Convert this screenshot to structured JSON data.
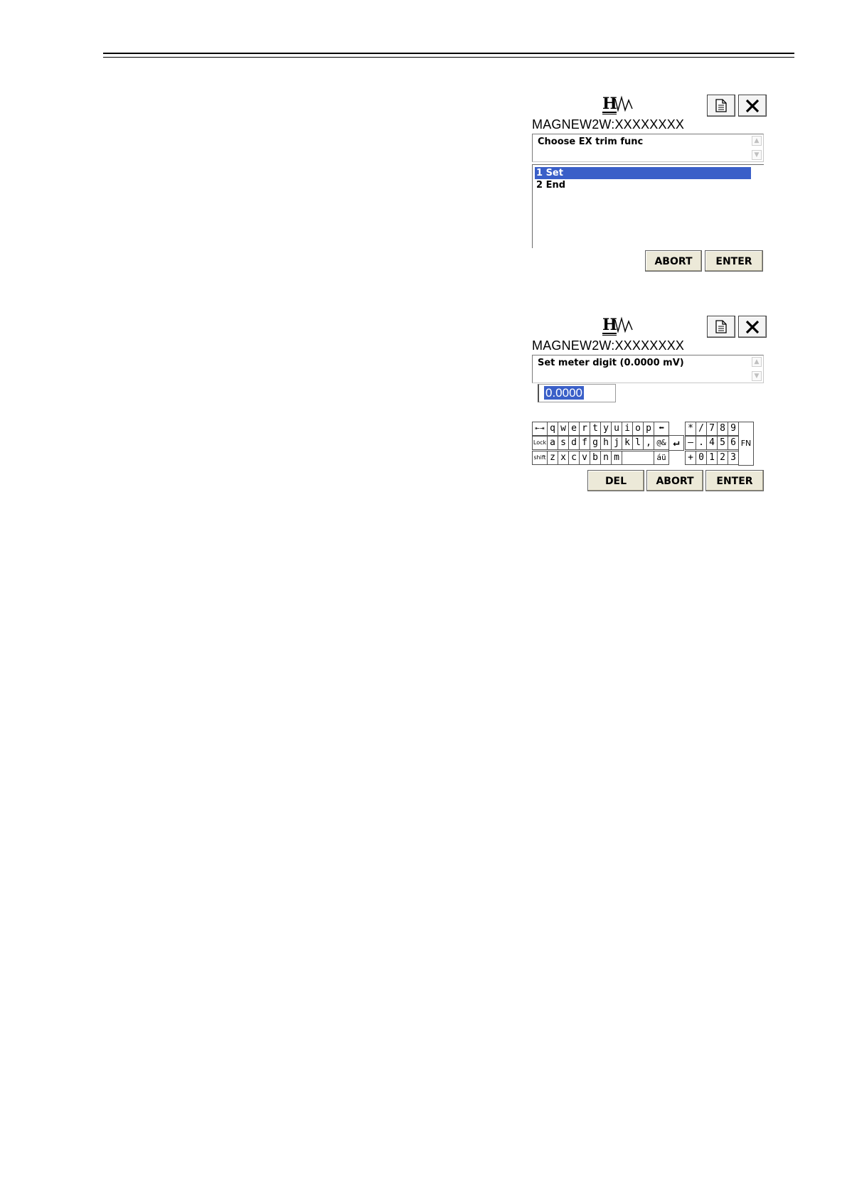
{
  "screen1": {
    "device_name": "MAGNEW2W:XXXXXXXX",
    "prompt": "Choose EX trim func",
    "options": [
      {
        "label": "1 Set",
        "selected": true
      },
      {
        "label": "2 End",
        "selected": false
      }
    ],
    "buttons": {
      "abort": "ABORT",
      "enter": "ENTER"
    },
    "icons": {
      "logo": "hart-logo-icon",
      "doc": "document-icon",
      "close": "close-icon"
    }
  },
  "screen2": {
    "device_name": "MAGNEW2W:XXXXXXXX",
    "prompt": "Set meter digit (0.0000 mV)",
    "input_value": "0.0000",
    "buttons": {
      "del": "DEL",
      "abort": "ABORT",
      "enter": "ENTER"
    },
    "keyboard": {
      "row1": [
        "q",
        "w",
        "e",
        "r",
        "t",
        "y",
        "u",
        "i",
        "o",
        "p"
      ],
      "row2": [
        "a",
        "s",
        "d",
        "f",
        "g",
        "h",
        "j",
        "k",
        "l",
        ","
      ],
      "row3": [
        "z",
        "x",
        "c",
        "v",
        "b",
        "n",
        "m"
      ],
      "tab": "⇤⇥",
      "lock": "Lock",
      "shift": "shift",
      "backspace": "⬅",
      "symbols": "@&",
      "accents": "áü",
      "enter": "↵",
      "numpad_row1": [
        "*",
        "/",
        "7",
        "8",
        "9"
      ],
      "numpad_row2": [
        "–",
        ".",
        "4",
        "5",
        "6"
      ],
      "numpad_row3": [
        "+",
        "0",
        "1",
        "2",
        "3"
      ],
      "fn": "FN"
    },
    "icons": {
      "logo": "hart-logo-icon",
      "doc": "document-icon",
      "close": "close-icon"
    }
  },
  "colors": {
    "selection": "#3a5fc8",
    "button_face": "#ece9d8"
  }
}
